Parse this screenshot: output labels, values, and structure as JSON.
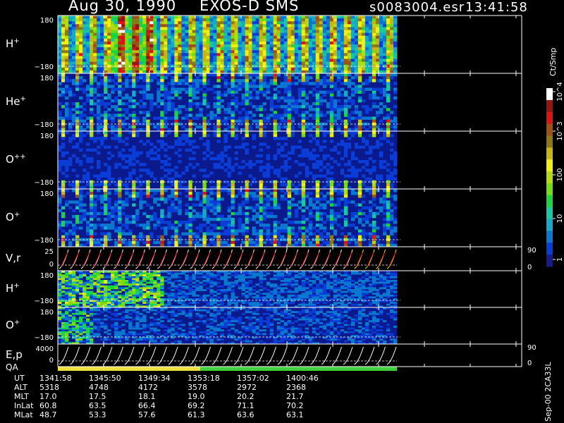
{
  "header": {
    "date": "Aug 30, 1990",
    "instrument": "EXOS-D SMS",
    "file": "s0083004.esr",
    "time": "13:41:58"
  },
  "footer_note": "Sep-00 2CA33L",
  "colorbar": {
    "title": "Ct/Smp",
    "tick_labels": [
      "1",
      "10",
      "100",
      "10^3",
      "10^4"
    ],
    "colors": [
      "#1a1a8c",
      "#0a3cd8",
      "#0a78d0",
      "#18a8c8",
      "#18c8a0",
      "#1cd43c",
      "#74dc14",
      "#b4dc14",
      "#f0f014",
      "#c8b414",
      "#8c7814",
      "#a05014",
      "#dc1414",
      "#961414",
      "#ffffff"
    ]
  },
  "chart_data": {
    "type": "heatmap",
    "panels": [
      {
        "label": "H",
        "sup": "+",
        "y_top": "180",
        "y_bottom": "−180",
        "right_top": "",
        "right_bottom": "",
        "activity": "high"
      },
      {
        "label": "He",
        "sup": "+",
        "y_top": "180",
        "y_bottom": "−180",
        "right_top": "",
        "right_bottom": "",
        "activity": "medium"
      },
      {
        "label": "O",
        "sup": "++",
        "y_top": "180",
        "y_bottom": "−180",
        "right_top": "",
        "right_bottom": "",
        "activity": "low"
      },
      {
        "label": "O",
        "sup": "+",
        "y_top": "180",
        "y_bottom": "−180",
        "right_top": "",
        "right_bottom": "",
        "activity": "medium"
      },
      {
        "label": "V,r",
        "sup": "",
        "y_top": "25",
        "y_bottom": "0",
        "right_top": "90",
        "right_bottom": "0",
        "activity": "line"
      },
      {
        "label": "H",
        "sup": "+",
        "y_top": "180",
        "y_bottom": "−180",
        "right_top": "",
        "right_bottom": "",
        "activity": "diffuse"
      },
      {
        "label": "O",
        "sup": "+",
        "y_top": "180",
        "y_bottom": "−180",
        "right_top": "",
        "right_bottom": "",
        "activity": "diffuse-low"
      },
      {
        "label": "E,p",
        "sup": "",
        "y_top": "4000",
        "y_bottom": "0",
        "right_top": "90",
        "right_bottom": "0",
        "activity": "line"
      }
    ],
    "qa": {
      "label": "QA",
      "segments": [
        {
          "fraction": 0.42,
          "color": "#f0e040"
        },
        {
          "fraction": 0.58,
          "color": "#40d040"
        }
      ]
    },
    "time_axis": {
      "rows": [
        {
          "label": "UT",
          "values": [
            "1341:58",
            "1345:50",
            "1349:34",
            "1353:18",
            "1357:02",
            "1400:46"
          ]
        },
        {
          "label": "ALT",
          "values": [
            "5318",
            "4748",
            "4172",
            "3578",
            "2972",
            "2368"
          ]
        },
        {
          "label": "MLT",
          "values": [
            "17.0",
            "17.5",
            "18.1",
            "19.0",
            "20.2",
            "21.7"
          ]
        },
        {
          "label": "InLat",
          "values": [
            "60.8",
            "63.5",
            "66.4",
            "69.2",
            "71.1",
            "70.2"
          ]
        },
        {
          "label": "MLat",
          "values": [
            "48.7",
            "53.3",
            "57.6",
            "61.3",
            "63.6",
            "63.1"
          ]
        }
      ]
    }
  }
}
